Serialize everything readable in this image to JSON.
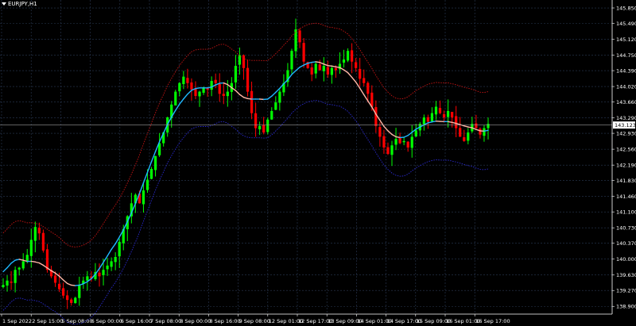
{
  "window": {
    "symbol": "EURJPY,H1"
  },
  "colors": {
    "background": "#000000",
    "grid": "#2b3a55",
    "bull": "#00ff00",
    "bear": "#ff0000",
    "ma_up": "#1fb8ff",
    "ma_down": "#ffb6a6",
    "upper_band": "#c81414",
    "lower_band": "#2a2ad0",
    "text": "#ffffff",
    "price_line": "#9a9a9a"
  },
  "chart_data": {
    "type": "candlestick",
    "title": "EURJPY,H1",
    "ylim": [
      138.72,
      146.035
    ],
    "y_ticks": [
      "145.850",
      "145.490",
      "145.120",
      "144.750",
      "144.390",
      "144.020",
      "143.660",
      "143.290",
      "142.930",
      "142.560",
      "142.190",
      "141.830",
      "141.460",
      "141.100",
      "140.730",
      "140.370",
      "140.000",
      "139.630",
      "139.270",
      "138.900"
    ],
    "x_ticks": [
      "1 Sep 2022",
      "2 Sep 15:00",
      "5 Sep 08:00",
      "6 Sep 00:00",
      "6 Sep 16:00",
      "7 Sep 08:00",
      "8 Sep 00:00",
      "8 Sep 16:00",
      "9 Sep 08:00",
      "12 Sep 01:00",
      "12 Sep 17:00",
      "13 Sep 09:00",
      "14 Sep 01:00",
      "14 Sep 17:00",
      "15 Sep 09:00",
      "16 Sep 01:00",
      "16 Sep 17:00"
    ],
    "current_price": "143.123",
    "grid": true,
    "price_path": [
      139.4,
      139.5,
      139.45,
      139.75,
      139.8,
      139.95,
      140.1,
      140.45,
      140.75,
      140.6,
      140.2,
      139.75,
      139.6,
      139.45,
      139.3,
      139.15,
      139.05,
      138.98,
      139.1,
      139.4,
      139.5,
      139.6,
      139.55,
      139.7,
      139.6,
      139.75,
      139.85,
      139.95,
      140.05,
      140.4,
      140.7,
      141.0,
      141.3,
      141.5,
      141.3,
      141.6,
      141.85,
      142.1,
      142.4,
      142.7,
      142.95,
      143.3,
      143.6,
      143.9,
      144.1,
      144.25,
      144.1,
      143.95,
      143.8,
      143.9,
      144.0,
      143.95,
      144.15,
      144.1,
      143.85,
      143.8,
      143.9,
      144.1,
      144.5,
      144.75,
      144.45,
      143.9,
      143.4,
      143.05,
      143.1,
      142.95,
      143.25,
      143.45,
      143.65,
      143.9,
      144.1,
      144.4,
      144.85,
      145.35,
      145.05,
      144.6,
      144.45,
      144.3,
      144.55,
      144.4,
      144.5,
      144.3,
      144.45,
      144.4,
      144.55,
      144.65,
      144.85,
      144.6,
      144.45,
      144.2,
      144.1,
      143.85,
      143.55,
      143.1,
      142.85,
      142.6,
      142.45,
      142.65,
      142.8,
      142.7,
      142.75,
      142.6,
      142.85,
      143.0,
      143.15,
      143.3,
      143.2,
      143.4,
      143.55,
      143.4,
      143.3,
      143.45,
      143.3,
      143.05,
      142.85,
      142.75,
      142.95,
      143.15,
      143.05,
      142.9,
      143.05,
      143.15
    ]
  }
}
